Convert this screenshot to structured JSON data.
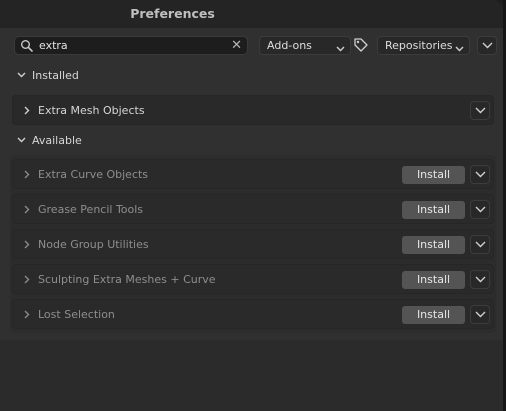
{
  "window": {
    "title": "Preferences"
  },
  "search": {
    "value": "extra",
    "clear_icon": "close-icon",
    "search_icon": "search-icon"
  },
  "filters": {
    "category": "Add-ons",
    "repository": "Repositories"
  },
  "sections": {
    "installed": {
      "label": "Installed",
      "items": [
        {
          "name": "Extra Mesh Objects"
        }
      ]
    },
    "available": {
      "label": "Available",
      "items": [
        {
          "name": "Extra Curve Objects",
          "action": "Install"
        },
        {
          "name": "Grease Pencil Tools",
          "action": "Install"
        },
        {
          "name": "Node Group Utilities",
          "action": "Install"
        },
        {
          "name": "Sculpting Extra Meshes + Curve",
          "action": "Install"
        },
        {
          "name": "Lost Selection",
          "action": "Install"
        }
      ]
    }
  },
  "colors": {
    "background": "#303030",
    "titlebar": "#242424",
    "install_button": "#545454"
  }
}
